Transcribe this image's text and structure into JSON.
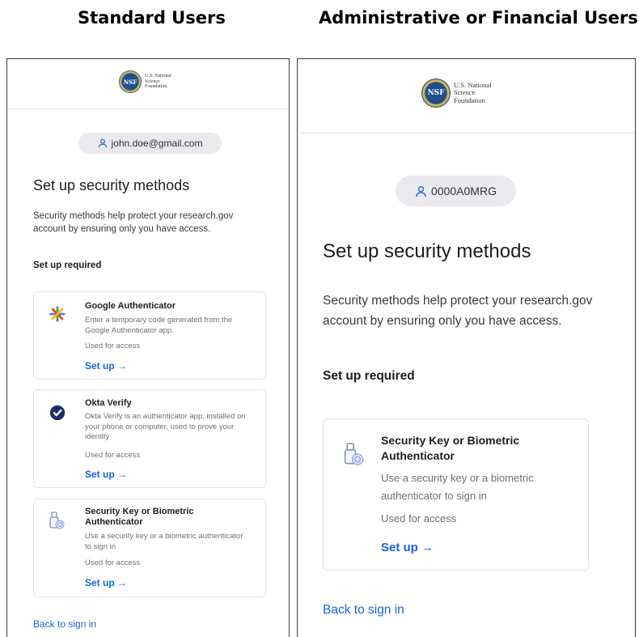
{
  "headings": {
    "left": "Standard Users",
    "right": "Administrative or Financial Users"
  },
  "logo": {
    "seal_text": "NSF",
    "line1": "U.S. National",
    "line2": "Science",
    "line3": "Foundation"
  },
  "left": {
    "user": "john.doe@gmail.com",
    "title": "Set up security methods",
    "description": "Security methods help protect your research.gov account by ensuring only you have access.",
    "required_label": "Set up required",
    "cards": [
      {
        "icon": "google-authenticator-icon",
        "title": "Google Authenticator",
        "description": "Enter a temporary code generated from the Google Authenticator app.",
        "used": "Used for access",
        "link": "Set up →"
      },
      {
        "icon": "okta-verify-icon",
        "title": "Okta Verify",
        "description": "Okta Verify is an authenticator app, installed on your phone or computer, used to prove your identity",
        "used": "Used for access",
        "link": "Set up →"
      },
      {
        "icon": "security-key-icon",
        "title": "Security Key or Biometric Authenticator",
        "description": "Use a security key or a biometric authenticator to sign in",
        "used": "Used for access",
        "link": "Set up →"
      }
    ],
    "back": "Back to sign in"
  },
  "right": {
    "user": "0000A0MRG",
    "title": "Set up security methods",
    "description": "Security methods help protect your research.gov account by ensuring only you have access.",
    "required_label": "Set up required",
    "cards": [
      {
        "icon": "security-key-icon",
        "title": "Security Key or Biometric Authenticator",
        "description": "Use a security key or a biometric authenticator to sign in",
        "used": "Used for access",
        "link": "Set up →"
      }
    ],
    "back": "Back to sign in"
  },
  "colors": {
    "link": "#1662dd",
    "pill_bg": "#eaeaee",
    "okta_blue": "#1a2e6e"
  }
}
